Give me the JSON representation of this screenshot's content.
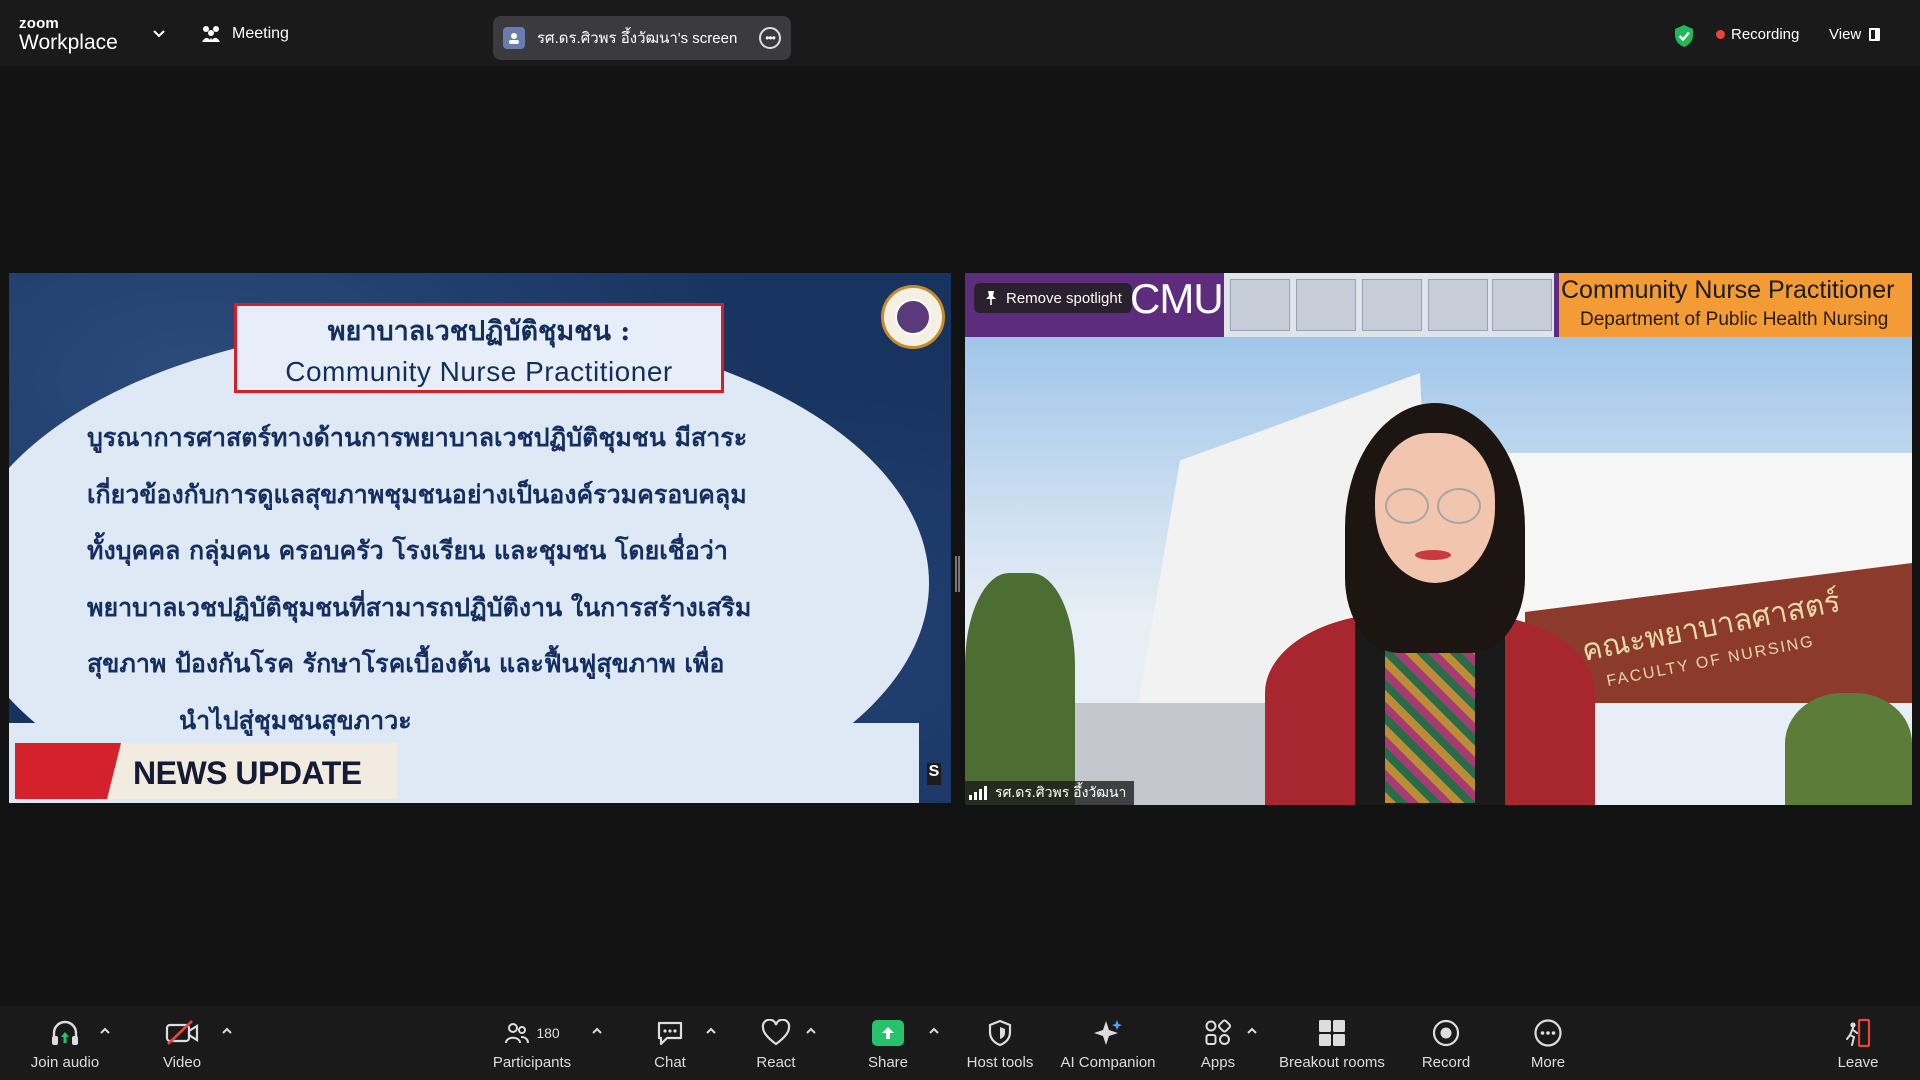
{
  "app": {
    "brand_small": "zoom",
    "brand_big": "Workplace",
    "meeting_label": "Meeting",
    "screen_share_label": "รศ.ดร.ศิวพร อึ้งวัฒนา's screen",
    "recording_label": "Recording",
    "view_label": "View"
  },
  "slide": {
    "title_th": "พยาบาลเวชปฏิบัติชุมชน :",
    "title_en": "Community Nurse Practitioner",
    "body_lines": [
      "บูรณาการศาสตร์ทางด้านการพยาบาลเวชปฏิบัติชุมชน มีสาระ",
      "เกี่ยวข้องกับการดูแลสุขภาพชุมชนอย่างเป็นองค์รวมครอบคลุม",
      "ทั้งบุคคล กลุ่มคน ครอบครัว โรงเรียน และชุมชน โดยเชื่อว่า",
      "พยาบาลเวชปฏิบัติชุมชนที่สามารถปฏิบัติงาน ในการสร้างเสริม",
      "สุขภาพ ป้องกันโรค รักษาโรคเบื้องต้น และฟื้นฟูสุขภาพ เพื่อ",
      "นำไปสู่ชุมชนสุขภาวะ"
    ],
    "news_label": "NEWS UPDATE",
    "news_tail": "S"
  },
  "video": {
    "banner_left": "CMU",
    "banner_title": "Community Nurse Practitioner",
    "banner_subtitle": "Department of Public Health Nursing",
    "wall_text_th": "คณะพยาบาลศาสตร์",
    "wall_text_en": "FACULTY OF NURSING",
    "spotlight_label": "Remove spotlight",
    "participant_name": "รศ.ดร.ศิวพร อึ้งวัฒนา"
  },
  "toolbar": {
    "join_audio": "Join audio",
    "video": "Video",
    "participants": "Participants",
    "participants_count": "180",
    "chat": "Chat",
    "react": "React",
    "share": "Share",
    "host_tools": "Host tools",
    "ai_companion": "AI Companion",
    "apps": "Apps",
    "breakout_rooms": "Breakout rooms",
    "record": "Record",
    "more": "More",
    "leave": "Leave"
  },
  "colors": {
    "accent_share": "#27c26c",
    "recording_dot": "#e8443a",
    "slide_title_border": "#d31f2a",
    "banner_purple": "#5d2c7c",
    "banner_orange": "#f39b34"
  }
}
